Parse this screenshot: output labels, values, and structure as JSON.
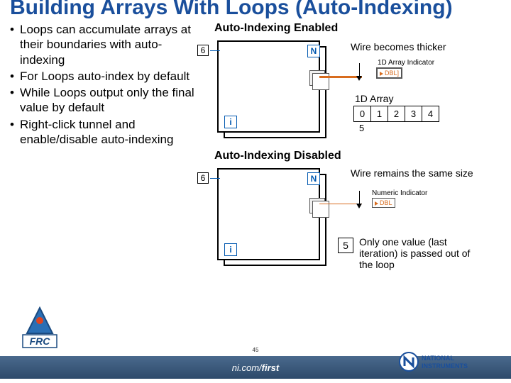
{
  "title": "Building Arrays With Loops (Auto-Indexing)",
  "bullets": [
    "Loops can accumulate arrays at their boundaries with auto-indexing",
    "For Loops auto-index by default",
    "While Loops output only the final value by default",
    "Right-click tunnel and enable/disable auto-indexing"
  ],
  "enabled": {
    "heading": "Auto-Indexing Enabled",
    "wire_note": "Wire becomes thicker",
    "indicator_label": "1D Array Indicator",
    "dbl": "DBL]",
    "n": "N",
    "i": "i",
    "six": "6",
    "array_title": "1D Array",
    "cells": [
      "0",
      "1",
      "2",
      "3",
      "4"
    ],
    "extra": "5"
  },
  "disabled": {
    "heading": "Auto-Indexing Disabled",
    "wire_note": "Wire remains the same size",
    "indicator_label": "Numeric Indicator",
    "dbl": "DBL",
    "n": "N",
    "i": "i",
    "six": "6",
    "scalar": "5",
    "note": "Only one value (last iteration) is passed out of the loop"
  },
  "footer": {
    "url_prefix": "ni.com/",
    "url_suffix": "first"
  },
  "page": "45",
  "ni_logo": "NATIONAL INSTRUMENTS",
  "frc_logo": "FRC"
}
